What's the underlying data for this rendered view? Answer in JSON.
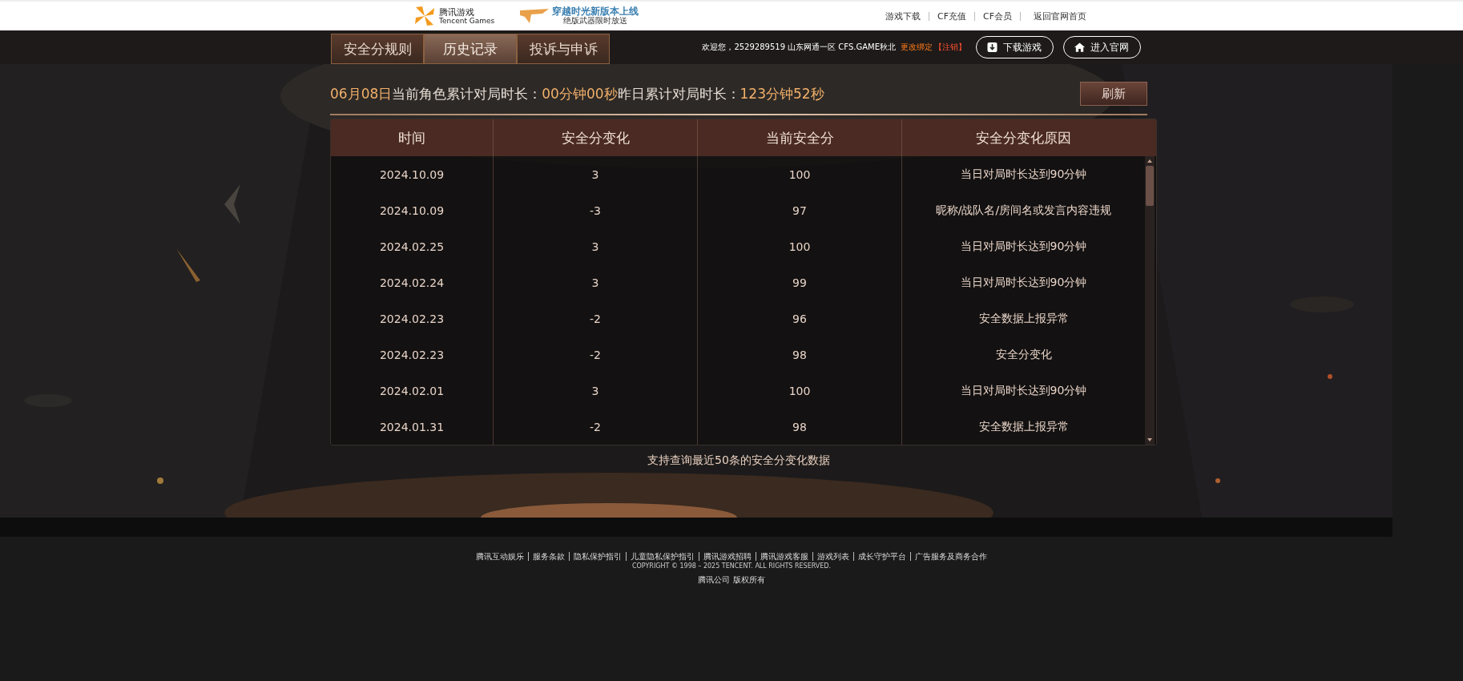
{
  "top_bar": {
    "logo": {
      "title": "腾讯游戏",
      "subtitle": "Tencent Games"
    },
    "promo": {
      "headline": "穿越时光新版本上线",
      "subline": "绝版武器限时放送"
    },
    "links": [
      "游戏下载",
      "CF充值",
      "CF会员"
    ],
    "home_link": "返回官网首页"
  },
  "nav": {
    "tabs": [
      {
        "label": "安全分规则",
        "selected": false
      },
      {
        "label": "历史记录",
        "selected": true
      },
      {
        "label": "投诉与申诉",
        "selected": false
      }
    ],
    "welcome": "欢迎您，2529289519 山东网通一区 CFS.GAME秋北",
    "change_binding": "更改绑定",
    "logout": "【注销】",
    "buttons": [
      {
        "kind": "download",
        "label": "下载游戏"
      },
      {
        "kind": "home",
        "label": "进入官网"
      }
    ]
  },
  "summary": {
    "date": "06月08日",
    "current_label": "当前角色累计对局时长：",
    "current_value": "00分钟00秒",
    "yesterday_label": "昨日累计对局时长：",
    "yesterday_value": "123分钟52秒"
  },
  "refresh_button": "刷新",
  "table": {
    "columns": [
      "时间",
      "安全分变化",
      "当前安全分",
      "安全分变化原因"
    ],
    "rows": [
      [
        "2024.10.09",
        "3",
        "100",
        "当日对局时长达到90分钟"
      ],
      [
        "2024.10.09",
        "-3",
        "97",
        "昵称/战队名/房间名或发言内容违规"
      ],
      [
        "2024.02.25",
        "3",
        "100",
        "当日对局时长达到90分钟"
      ],
      [
        "2024.02.24",
        "3",
        "99",
        "当日对局时长达到90分钟"
      ],
      [
        "2024.02.23",
        "-2",
        "96",
        "安全数据上报异常"
      ],
      [
        "2024.02.23",
        "-2",
        "98",
        "安全分变化"
      ],
      [
        "2024.02.01",
        "3",
        "100",
        "当日对局时长达到90分钟"
      ],
      [
        "2024.01.31",
        "-2",
        "98",
        "安全数据上报异常"
      ]
    ]
  },
  "note": "支持查询最近50条的安全分变化数据",
  "footer": {
    "links": [
      "腾讯互动娱乐",
      "服务条款",
      "隐私保护指引",
      "儿童隐私保护指引",
      "腾讯游戏招聘",
      "腾讯游戏客服",
      "游戏列表",
      "成长守护平台",
      "广告服务及商务合作"
    ],
    "copyright": "COPYRIGHT © 1998 – 2025 TENCENT. ALL RIGHTS RESERVED.",
    "company": "腾讯公司 版权所有"
  }
}
